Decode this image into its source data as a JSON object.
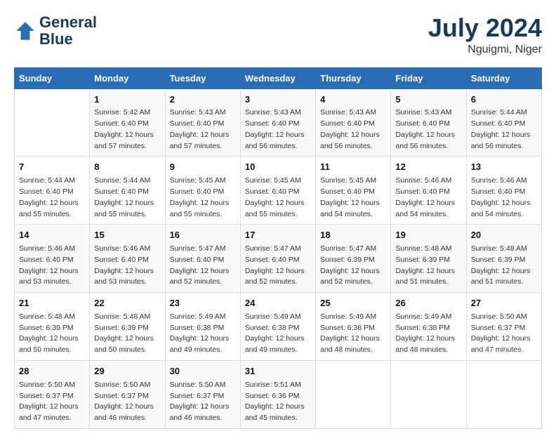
{
  "header": {
    "logo_line1": "General",
    "logo_line2": "Blue",
    "month_year": "July 2024",
    "location": "Nguigmi, Niger"
  },
  "columns": [
    "Sunday",
    "Monday",
    "Tuesday",
    "Wednesday",
    "Thursday",
    "Friday",
    "Saturday"
  ],
  "weeks": [
    [
      {
        "day": "",
        "info": ""
      },
      {
        "day": "1",
        "info": "Sunrise: 5:42 AM\nSunset: 6:40 PM\nDaylight: 12 hours\nand 57 minutes."
      },
      {
        "day": "2",
        "info": "Sunrise: 5:43 AM\nSunset: 6:40 PM\nDaylight: 12 hours\nand 57 minutes."
      },
      {
        "day": "3",
        "info": "Sunrise: 5:43 AM\nSunset: 6:40 PM\nDaylight: 12 hours\nand 56 minutes."
      },
      {
        "day": "4",
        "info": "Sunrise: 5:43 AM\nSunset: 6:40 PM\nDaylight: 12 hours\nand 56 minutes."
      },
      {
        "day": "5",
        "info": "Sunrise: 5:43 AM\nSunset: 6:40 PM\nDaylight: 12 hours\nand 56 minutes."
      },
      {
        "day": "6",
        "info": "Sunrise: 5:44 AM\nSunset: 6:40 PM\nDaylight: 12 hours\nand 56 minutes."
      }
    ],
    [
      {
        "day": "7",
        "info": "Sunrise: 5:44 AM\nSunset: 6:40 PM\nDaylight: 12 hours\nand 55 minutes."
      },
      {
        "day": "8",
        "info": "Sunrise: 5:44 AM\nSunset: 6:40 PM\nDaylight: 12 hours\nand 55 minutes."
      },
      {
        "day": "9",
        "info": "Sunrise: 5:45 AM\nSunset: 6:40 PM\nDaylight: 12 hours\nand 55 minutes."
      },
      {
        "day": "10",
        "info": "Sunrise: 5:45 AM\nSunset: 6:40 PM\nDaylight: 12 hours\nand 55 minutes."
      },
      {
        "day": "11",
        "info": "Sunrise: 5:45 AM\nSunset: 6:40 PM\nDaylight: 12 hours\nand 54 minutes."
      },
      {
        "day": "12",
        "info": "Sunrise: 5:46 AM\nSunset: 6:40 PM\nDaylight: 12 hours\nand 54 minutes."
      },
      {
        "day": "13",
        "info": "Sunrise: 5:46 AM\nSunset: 6:40 PM\nDaylight: 12 hours\nand 54 minutes."
      }
    ],
    [
      {
        "day": "14",
        "info": "Sunrise: 5:46 AM\nSunset: 6:40 PM\nDaylight: 12 hours\nand 53 minutes."
      },
      {
        "day": "15",
        "info": "Sunrise: 5:46 AM\nSunset: 6:40 PM\nDaylight: 12 hours\nand 53 minutes."
      },
      {
        "day": "16",
        "info": "Sunrise: 5:47 AM\nSunset: 6:40 PM\nDaylight: 12 hours\nand 52 minutes."
      },
      {
        "day": "17",
        "info": "Sunrise: 5:47 AM\nSunset: 6:40 PM\nDaylight: 12 hours\nand 52 minutes."
      },
      {
        "day": "18",
        "info": "Sunrise: 5:47 AM\nSunset: 6:39 PM\nDaylight: 12 hours\nand 52 minutes."
      },
      {
        "day": "19",
        "info": "Sunrise: 5:48 AM\nSunset: 6:39 PM\nDaylight: 12 hours\nand 51 minutes."
      },
      {
        "day": "20",
        "info": "Sunrise: 5:48 AM\nSunset: 6:39 PM\nDaylight: 12 hours\nand 51 minutes."
      }
    ],
    [
      {
        "day": "21",
        "info": "Sunrise: 5:48 AM\nSunset: 6:39 PM\nDaylight: 12 hours\nand 50 minutes."
      },
      {
        "day": "22",
        "info": "Sunrise: 5:48 AM\nSunset: 6:39 PM\nDaylight: 12 hours\nand 50 minutes."
      },
      {
        "day": "23",
        "info": "Sunrise: 5:49 AM\nSunset: 6:38 PM\nDaylight: 12 hours\nand 49 minutes."
      },
      {
        "day": "24",
        "info": "Sunrise: 5:49 AM\nSunset: 6:38 PM\nDaylight: 12 hours\nand 49 minutes."
      },
      {
        "day": "25",
        "info": "Sunrise: 5:49 AM\nSunset: 6:38 PM\nDaylight: 12 hours\nand 48 minutes."
      },
      {
        "day": "26",
        "info": "Sunrise: 5:49 AM\nSunset: 6:38 PM\nDaylight: 12 hours\nand 48 minutes."
      },
      {
        "day": "27",
        "info": "Sunrise: 5:50 AM\nSunset: 6:37 PM\nDaylight: 12 hours\nand 47 minutes."
      }
    ],
    [
      {
        "day": "28",
        "info": "Sunrise: 5:50 AM\nSunset: 6:37 PM\nDaylight: 12 hours\nand 47 minutes."
      },
      {
        "day": "29",
        "info": "Sunrise: 5:50 AM\nSunset: 6:37 PM\nDaylight: 12 hours\nand 46 minutes."
      },
      {
        "day": "30",
        "info": "Sunrise: 5:50 AM\nSunset: 6:37 PM\nDaylight: 12 hours\nand 46 minutes."
      },
      {
        "day": "31",
        "info": "Sunrise: 5:51 AM\nSunset: 6:36 PM\nDaylight: 12 hours\nand 45 minutes."
      },
      {
        "day": "",
        "info": ""
      },
      {
        "day": "",
        "info": ""
      },
      {
        "day": "",
        "info": ""
      }
    ]
  ]
}
